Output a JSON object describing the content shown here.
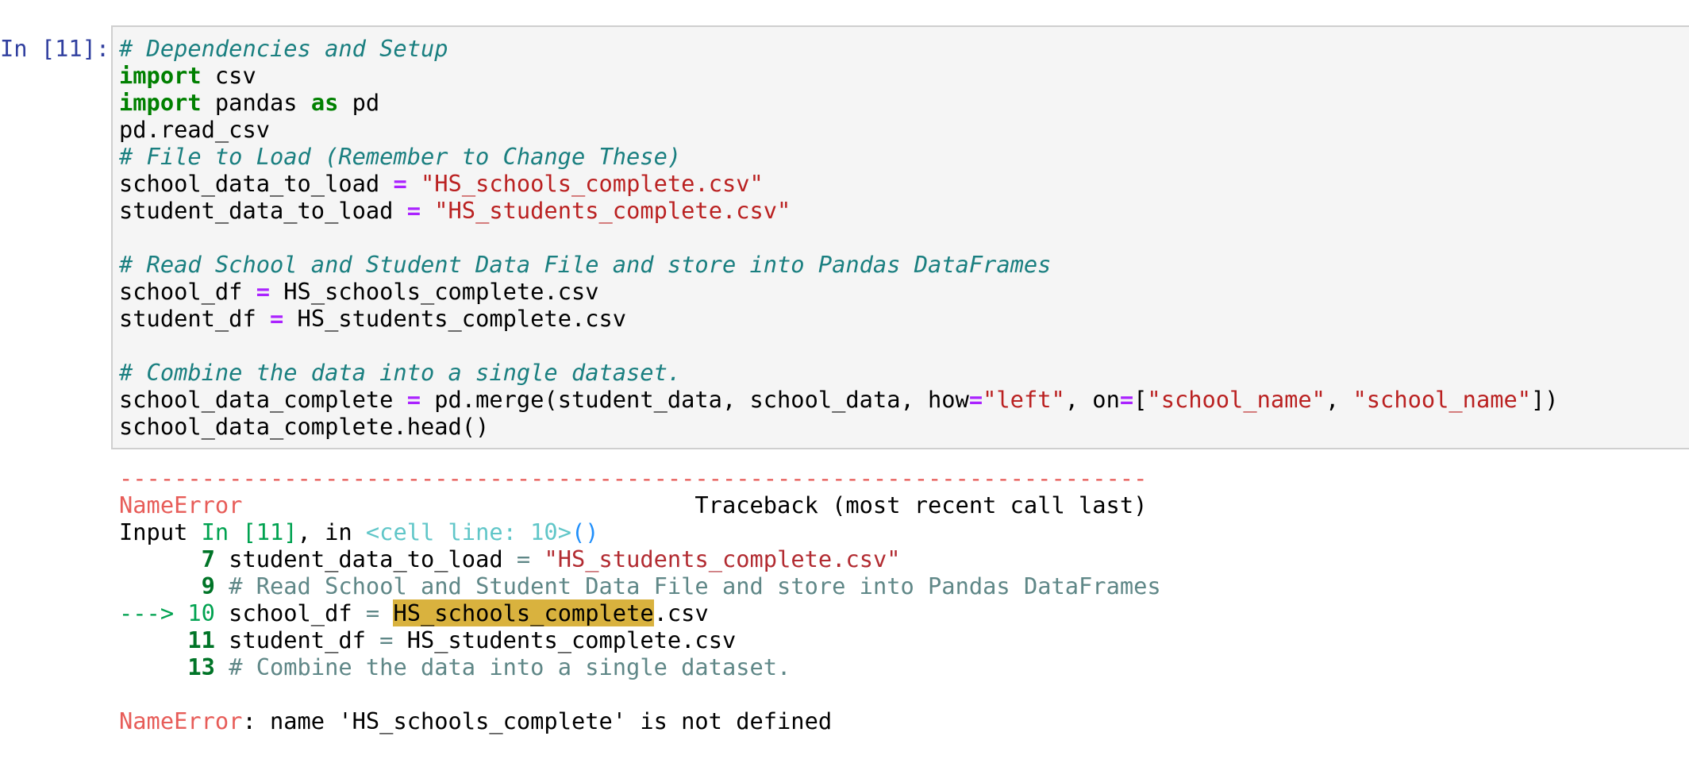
{
  "cell": {
    "prompt": "In [11]:",
    "code_lines": [
      [
        {
          "t": "# Dependencies and Setup",
          "c": "c-comment"
        }
      ],
      [
        {
          "t": "import",
          "c": "c-kw"
        },
        {
          "t": " csv",
          "c": ""
        }
      ],
      [
        {
          "t": "import",
          "c": "c-kw"
        },
        {
          "t": " pandas ",
          "c": ""
        },
        {
          "t": "as",
          "c": "c-kw"
        },
        {
          "t": " pd",
          "c": ""
        }
      ],
      [
        {
          "t": "pd.read_csv",
          "c": ""
        }
      ],
      [
        {
          "t": "# File to Load (Remember to Change These)",
          "c": "c-comment"
        }
      ],
      [
        {
          "t": "school_data_to_load ",
          "c": ""
        },
        {
          "t": "=",
          "c": "c-op"
        },
        {
          "t": " ",
          "c": ""
        },
        {
          "t": "\"HS_schools_complete.csv\"",
          "c": "c-str"
        }
      ],
      [
        {
          "t": "student_data_to_load ",
          "c": ""
        },
        {
          "t": "=",
          "c": "c-op"
        },
        {
          "t": " ",
          "c": ""
        },
        {
          "t": "\"HS_students_complete.csv\"",
          "c": "c-str"
        }
      ],
      [],
      [
        {
          "t": "# Read School and Student Data File and store into Pandas DataFrames",
          "c": "c-comment"
        }
      ],
      [
        {
          "t": "school_df ",
          "c": ""
        },
        {
          "t": "=",
          "c": "c-op"
        },
        {
          "t": " HS_schools_complete.csv",
          "c": ""
        }
      ],
      [
        {
          "t": "student_df ",
          "c": ""
        },
        {
          "t": "=",
          "c": "c-op"
        },
        {
          "t": " HS_students_complete.csv",
          "c": ""
        }
      ],
      [],
      [
        {
          "t": "# Combine the data into a single dataset.",
          "c": "c-comment"
        }
      ],
      [
        {
          "t": "school_data_complete ",
          "c": ""
        },
        {
          "t": "=",
          "c": "c-op"
        },
        {
          "t": " pd.merge(student_data, school_data, how",
          "c": ""
        },
        {
          "t": "=",
          "c": "c-op"
        },
        {
          "t": "\"left\"",
          "c": "c-str"
        },
        {
          "t": ", on",
          "c": ""
        },
        {
          "t": "=",
          "c": "c-op"
        },
        {
          "t": "[",
          "c": ""
        },
        {
          "t": "\"school_name\"",
          "c": "c-str"
        },
        {
          "t": ", ",
          "c": ""
        },
        {
          "t": "\"school_name\"",
          "c": "c-str"
        },
        {
          "t": "])",
          "c": ""
        }
      ],
      [
        {
          "t": "school_data_complete.head()",
          "c": ""
        }
      ]
    ]
  },
  "error_output": {
    "lines": [
      [
        {
          "t": "---------------------------------------------------------------------------",
          "c": "e-red"
        }
      ],
      [
        {
          "t": "NameError",
          "c": "e-red"
        },
        {
          "t": "                                 Traceback (most recent call last)",
          "c": ""
        }
      ],
      [
        {
          "t": "Input ",
          "c": ""
        },
        {
          "t": "In [11]",
          "c": "e-green"
        },
        {
          "t": ", in ",
          "c": ""
        },
        {
          "t": "<cell line: 10>",
          "c": "e-cyan"
        },
        {
          "t": "()",
          "c": "e-blue"
        }
      ],
      [
        {
          "t": "      ",
          "c": ""
        },
        {
          "t": "7",
          "c": "e-dkgreen"
        },
        {
          "t": " student_data_to_load ",
          "c": ""
        },
        {
          "t": "=",
          "c": "e-gray"
        },
        {
          "t": " ",
          "c": ""
        },
        {
          "t": "\"HS_students_complete.csv\"",
          "c": "e-str"
        }
      ],
      [
        {
          "t": "      ",
          "c": ""
        },
        {
          "t": "9",
          "c": "e-dkgreen"
        },
        {
          "t": " ",
          "c": ""
        },
        {
          "t": "# Read School and Student Data File and store into Pandas DataFrames",
          "c": "e-gray"
        }
      ],
      [
        {
          "t": "---> 10",
          "c": "e-green"
        },
        {
          "t": " school_df ",
          "c": ""
        },
        {
          "t": "=",
          "c": "e-gray"
        },
        {
          "t": " ",
          "c": ""
        },
        {
          "t": "HS_schools_complete",
          "c": "hl"
        },
        {
          "t": ".csv",
          "c": ""
        }
      ],
      [
        {
          "t": "     ",
          "c": ""
        },
        {
          "t": "11",
          "c": "e-dkgreen"
        },
        {
          "t": " student_df ",
          "c": ""
        },
        {
          "t": "=",
          "c": "e-gray"
        },
        {
          "t": " HS_students_complete.csv",
          "c": ""
        }
      ],
      [
        {
          "t": "     ",
          "c": ""
        },
        {
          "t": "13",
          "c": "e-dkgreen"
        },
        {
          "t": " ",
          "c": ""
        },
        {
          "t": "# Combine the data into a single dataset.",
          "c": "e-gray"
        }
      ],
      [],
      [
        {
          "t": "NameError",
          "c": "e-red"
        },
        {
          "t": ": name 'HS_schools_complete' is not defined",
          "c": ""
        }
      ]
    ]
  }
}
